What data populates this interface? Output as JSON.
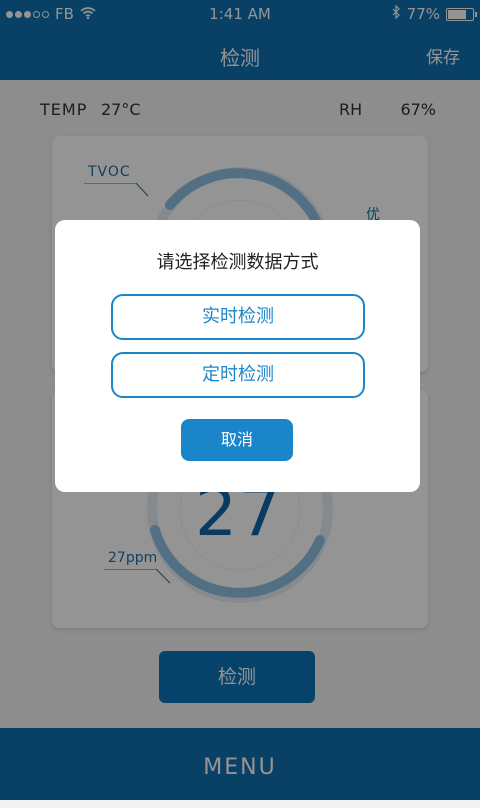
{
  "status": {
    "carrier": "FB",
    "time": "1:41 AM",
    "battery": "77%",
    "battery_level": 0.77
  },
  "nav": {
    "title": "检测",
    "save_label": "保存"
  },
  "readings": {
    "temp_label": "TEMP",
    "temp_value": "27°C",
    "rh_label": "RH",
    "rh_value": "67%"
  },
  "gauge_tvoc": {
    "label": "TVOC",
    "quality": "优"
  },
  "gauge_main": {
    "value": "27",
    "unit_label": "27ppm"
  },
  "detect_button": "检测",
  "menu_label": "MENU",
  "dialog": {
    "title": "请选择检测数据方式",
    "option_realtime": "实时检测",
    "option_timed": "定时检测",
    "cancel_label": "取消"
  },
  "colors": {
    "primary": "#0f6fb0",
    "accent": "#1a86c9"
  }
}
